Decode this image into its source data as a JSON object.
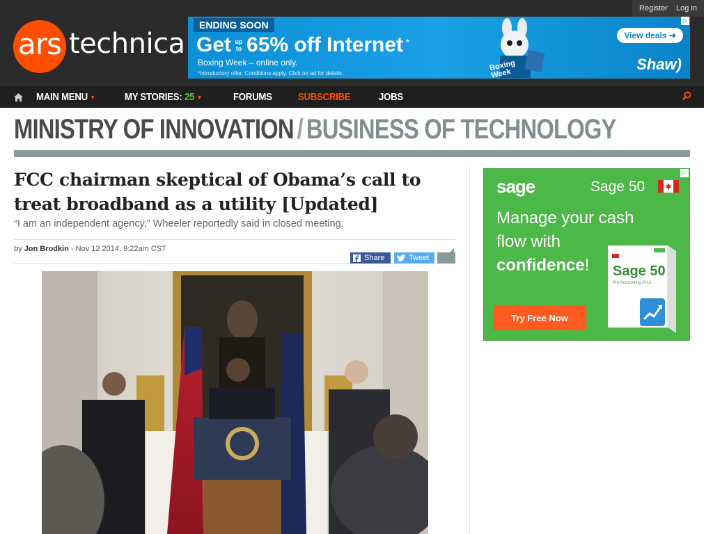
{
  "account": {
    "register": "Register",
    "login": "Log in"
  },
  "logo": {
    "ars": "ars",
    "technica": "technica"
  },
  "banner_ad": {
    "ending": "ENDING SOON",
    "get": "Get",
    "up_to": "up to",
    "offer": "65% off Internet",
    "asterisk": "*",
    "sub": "Boxing Week – online only.",
    "fine": "*Introductory offer. Conditions apply. Click on ad for details.",
    "bunny_tag": "Boxing Week",
    "cta": "View deals",
    "brand": "Shaw)"
  },
  "nav": {
    "main_menu": "MAIN MENU",
    "my_stories": "MY STORIES:",
    "stories_count": "25",
    "forums": "FORUMS",
    "subscribe": "SUBSCRIBE",
    "jobs": "JOBS"
  },
  "section": {
    "primary": "MINISTRY OF INNOVATION",
    "separator": "/",
    "secondary": "BUSINESS OF TECHNOLOGY"
  },
  "article": {
    "headline": "FCC chairman skeptical of Obama’s call to treat broadband as a utility [Updated]",
    "dek": "“I am an independent agency,” Wheeler reportedly said in closed meeting.",
    "by": "by",
    "author": "Jon Brodkin",
    "date": " - Nov 12 2014, 9:22am CST",
    "share_fb": "Share",
    "share_tw": "Tweet"
  },
  "side_ad": {
    "logo": "sage",
    "product": "Sage 50",
    "copy_1": "Manage your cash flow with",
    "copy_2": "confidence",
    "copy_3": "!",
    "cta": "Try Free Now",
    "box_title": "Sage 50",
    "box_sub": "Pro Accounting 2013"
  },
  "colors": {
    "accent": "#ff4e00",
    "stories_count": "#5bc236",
    "section_rule": "#8a9a9a",
    "ad_green": "#4cb848",
    "facebook": "#3b5998",
    "twitter": "#55acee"
  },
  "icons": {
    "home": "home-icon",
    "search": "search-icon",
    "comments": "comment-icon"
  }
}
